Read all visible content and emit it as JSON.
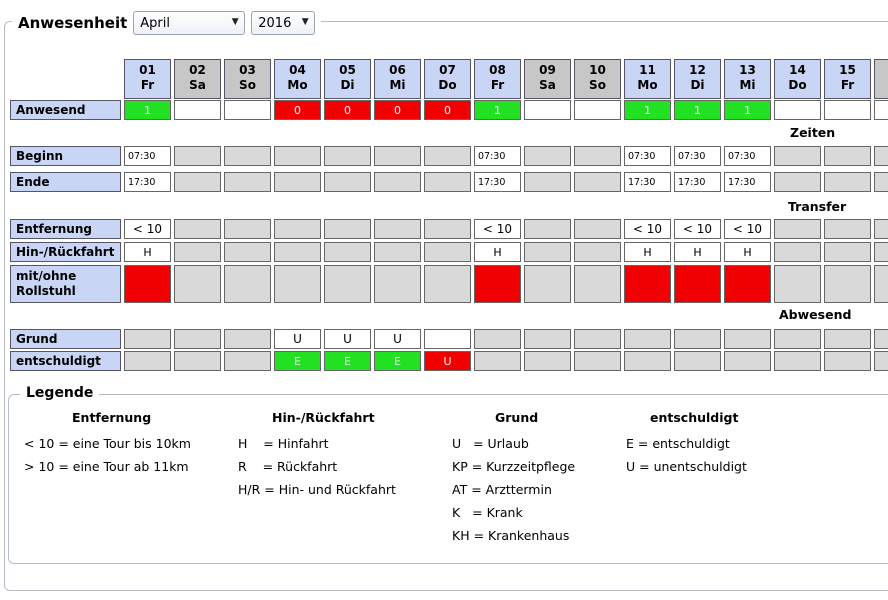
{
  "title": "Anwesenheit",
  "month_select": {
    "value": "April"
  },
  "year_select": {
    "value": "2016"
  },
  "days": [
    {
      "num": "01",
      "wd": "Fr",
      "weekend": false
    },
    {
      "num": "02",
      "wd": "Sa",
      "weekend": true
    },
    {
      "num": "03",
      "wd": "So",
      "weekend": true
    },
    {
      "num": "04",
      "wd": "Mo",
      "weekend": false
    },
    {
      "num": "05",
      "wd": "Di",
      "weekend": false
    },
    {
      "num": "06",
      "wd": "Mi",
      "weekend": false
    },
    {
      "num": "07",
      "wd": "Do",
      "weekend": false
    },
    {
      "num": "08",
      "wd": "Fr",
      "weekend": false
    },
    {
      "num": "09",
      "wd": "Sa",
      "weekend": true
    },
    {
      "num": "10",
      "wd": "So",
      "weekend": true
    },
    {
      "num": "11",
      "wd": "Mo",
      "weekend": false
    },
    {
      "num": "12",
      "wd": "Di",
      "weekend": false
    },
    {
      "num": "13",
      "wd": "Mi",
      "weekend": false
    },
    {
      "num": "14",
      "wd": "Do",
      "weekend": false
    },
    {
      "num": "15",
      "wd": "Fr",
      "weekend": false
    },
    {
      "num": "",
      "wd": "",
      "weekend": true
    }
  ],
  "rows": {
    "anwesend": {
      "label": "Anwesend",
      "cells": [
        [
          "1",
          "g"
        ],
        [
          "",
          "w"
        ],
        [
          "",
          "w"
        ],
        [
          "0",
          "r"
        ],
        [
          "0",
          "r"
        ],
        [
          "0",
          "r"
        ],
        [
          "0",
          "r"
        ],
        [
          "1",
          "g"
        ],
        [
          "",
          "w"
        ],
        [
          "",
          "w"
        ],
        [
          "1",
          "g"
        ],
        [
          "1",
          "g"
        ],
        [
          "1",
          "g"
        ],
        [
          "",
          "w"
        ],
        [
          "",
          "w"
        ],
        [
          "",
          "w"
        ]
      ]
    },
    "beginn": {
      "label": "Beginn",
      "cells": [
        [
          "07:30",
          "w t"
        ],
        [
          "",
          ""
        ],
        [
          "",
          ""
        ],
        [
          "",
          ""
        ],
        [
          "",
          ""
        ],
        [
          "",
          ""
        ],
        [
          "",
          ""
        ],
        [
          "07:30",
          "w t"
        ],
        [
          "",
          ""
        ],
        [
          "",
          ""
        ],
        [
          "07:30",
          "w t"
        ],
        [
          "07:30",
          "w t"
        ],
        [
          "07:30",
          "w t"
        ],
        [
          "",
          ""
        ],
        [
          "",
          ""
        ],
        [
          "",
          ""
        ]
      ]
    },
    "ende": {
      "label": "Ende",
      "cells": [
        [
          "17:30",
          "w t"
        ],
        [
          "",
          ""
        ],
        [
          "",
          ""
        ],
        [
          "",
          ""
        ],
        [
          "",
          ""
        ],
        [
          "",
          ""
        ],
        [
          "",
          ""
        ],
        [
          "17:30",
          "w t"
        ],
        [
          "",
          ""
        ],
        [
          "",
          ""
        ],
        [
          "17:30",
          "w t"
        ],
        [
          "17:30",
          "w t"
        ],
        [
          "17:30",
          "w t"
        ],
        [
          "",
          ""
        ],
        [
          "",
          ""
        ],
        [
          "",
          ""
        ]
      ]
    },
    "entfernung": {
      "label": "Entfernung",
      "cells": [
        [
          "< 10",
          "w c"
        ],
        [
          "",
          ""
        ],
        [
          "",
          ""
        ],
        [
          "",
          ""
        ],
        [
          "",
          ""
        ],
        [
          "",
          ""
        ],
        [
          "",
          ""
        ],
        [
          "< 10",
          "w c"
        ],
        [
          "",
          ""
        ],
        [
          "",
          ""
        ],
        [
          "< 10",
          "w c"
        ],
        [
          "< 10",
          "w c"
        ],
        [
          "< 10",
          "w c"
        ],
        [
          "",
          ""
        ],
        [
          "",
          ""
        ],
        [
          "",
          ""
        ]
      ]
    },
    "hinrueck": {
      "label": "Hin-/Rückfahrt",
      "cells": [
        [
          "H",
          "w"
        ],
        [
          "",
          ""
        ],
        [
          "",
          ""
        ],
        [
          "",
          ""
        ],
        [
          "",
          ""
        ],
        [
          "",
          ""
        ],
        [
          "",
          ""
        ],
        [
          "H",
          "w"
        ],
        [
          "",
          ""
        ],
        [
          "",
          ""
        ],
        [
          "H",
          "w"
        ],
        [
          "H",
          "w"
        ],
        [
          "H",
          "w"
        ],
        [
          "",
          ""
        ],
        [
          "",
          ""
        ],
        [
          "",
          ""
        ]
      ]
    },
    "rollstuhl": {
      "label": "mit/ohne Rollstuhl",
      "cells": [
        [
          "",
          "r"
        ],
        [
          "",
          ""
        ],
        [
          "",
          ""
        ],
        [
          "",
          ""
        ],
        [
          "",
          ""
        ],
        [
          "",
          ""
        ],
        [
          "",
          ""
        ],
        [
          "",
          "r"
        ],
        [
          "",
          ""
        ],
        [
          "",
          ""
        ],
        [
          "",
          "r"
        ],
        [
          "",
          "r"
        ],
        [
          "",
          "r"
        ],
        [
          "",
          ""
        ],
        [
          "",
          ""
        ],
        [
          "",
          ""
        ]
      ]
    },
    "grund": {
      "label": "Grund",
      "cells": [
        [
          "",
          ""
        ],
        [
          "",
          ""
        ],
        [
          "",
          ""
        ],
        [
          "U",
          "w c"
        ],
        [
          "U",
          "w c"
        ],
        [
          "U",
          "w c"
        ],
        [
          "",
          "w"
        ],
        [
          "",
          ""
        ],
        [
          "",
          ""
        ],
        [
          "",
          ""
        ],
        [
          "",
          ""
        ],
        [
          "",
          ""
        ],
        [
          "",
          ""
        ],
        [
          "",
          ""
        ],
        [
          "",
          ""
        ],
        [
          "",
          ""
        ]
      ]
    },
    "entschuldigt": {
      "label": "entschuldigt",
      "cells": [
        [
          "",
          ""
        ],
        [
          "",
          ""
        ],
        [
          "",
          ""
        ],
        [
          "E",
          "g"
        ],
        [
          "E",
          "g"
        ],
        [
          "E",
          "g"
        ],
        [
          "U",
          "r"
        ],
        [
          "",
          ""
        ],
        [
          "",
          ""
        ],
        [
          "",
          ""
        ],
        [
          "",
          ""
        ],
        [
          "",
          ""
        ],
        [
          "",
          ""
        ],
        [
          "",
          ""
        ],
        [
          "",
          ""
        ],
        [
          "",
          ""
        ]
      ]
    }
  },
  "sections": {
    "zeiten": "Zeiten",
    "transfer": "Transfer",
    "abwesend": "Abwesend"
  },
  "legend": {
    "title": "Legende",
    "entfernung": {
      "heading": "Entfernung",
      "items": [
        "< 10 = eine Tour bis 10km",
        "> 10 = eine Tour ab 11km"
      ]
    },
    "hinrueck": {
      "heading": "Hin-/Rückfahrt",
      "items": [
        "H    = Hinfahrt",
        "R    = Rückfahrt",
        "H/R = Hin- und Rückfahrt"
      ]
    },
    "grund": {
      "heading": "Grund",
      "items": [
        "U   = Urlaub",
        "KP = Kurzzeitpflege",
        "AT = Arzttermin",
        "K   = Krank",
        "KH = Krankenhaus"
      ]
    },
    "entschuldigt": {
      "heading": "entschuldigt",
      "items": [
        "E = entschuldigt",
        "U = unentschuldigt"
      ]
    }
  },
  "colors": {
    "weekday_header": "#c9d5f5",
    "weekend_header": "#c7c7c7",
    "present": "#22e022",
    "absent": "#f00000",
    "empty": "#d9d9d9"
  }
}
